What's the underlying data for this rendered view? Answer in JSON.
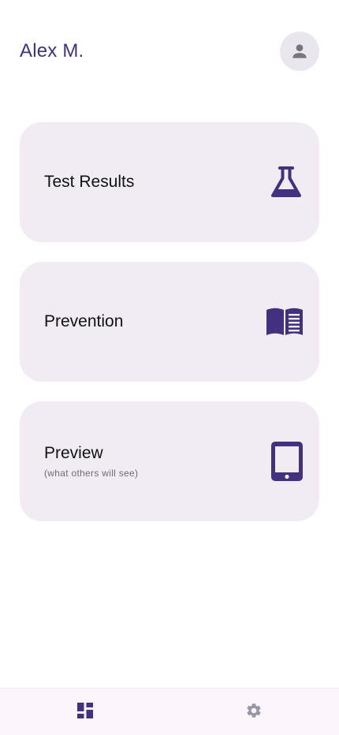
{
  "header": {
    "user_name": "Alex M.",
    "avatar_icon": "person-icon"
  },
  "cards": [
    {
      "title": "Test Results",
      "subtitle": "",
      "icon": "flask-icon"
    },
    {
      "title": "Prevention",
      "subtitle": "",
      "icon": "book-icon"
    },
    {
      "title": "Preview",
      "subtitle": "(what others will see)",
      "icon": "tablet-icon"
    }
  ],
  "bottom_nav": {
    "items": [
      {
        "icon": "dashboard-icon",
        "active": true
      },
      {
        "icon": "settings-gear-icon",
        "active": false
      }
    ]
  },
  "colors": {
    "accent": "#43307e",
    "card_background": "#f1ecf4",
    "avatar_background": "#e9e6ee",
    "nav_background": "#fcf5fb",
    "inactive_icon": "#9a95a6"
  }
}
